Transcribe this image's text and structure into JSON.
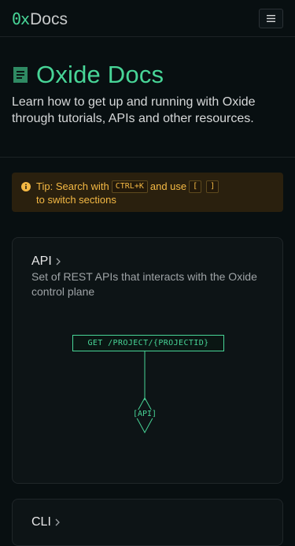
{
  "header": {
    "logo_mark": "0x",
    "logo_word": "Docs",
    "menu_icon": "hamburger-menu-icon"
  },
  "hero": {
    "icon": "document-icon",
    "title": "Oxide Docs",
    "subtitle": "Learn how to get up and running with Oxide through tutorials, APIs and other resources."
  },
  "tip": {
    "icon": "info-icon",
    "label": "Tip:",
    "text_before": "Search with",
    "shortcut": "CTRL+K",
    "text_middle": "and use",
    "key_left": "[",
    "key_right": "]",
    "text_after": "to switch sections"
  },
  "cards": {
    "api": {
      "title": "API",
      "description": "Set of REST APIs that interacts with the Oxide control plane",
      "endpoint": "GET /PROJECT/{PROJECTID}",
      "node_label": "[API]"
    },
    "cli": {
      "title": "CLI"
    }
  },
  "colors": {
    "accent": "#48d597",
    "background": "#080f11",
    "tip_bg": "#2a200e",
    "tip_text": "#f5b944"
  }
}
